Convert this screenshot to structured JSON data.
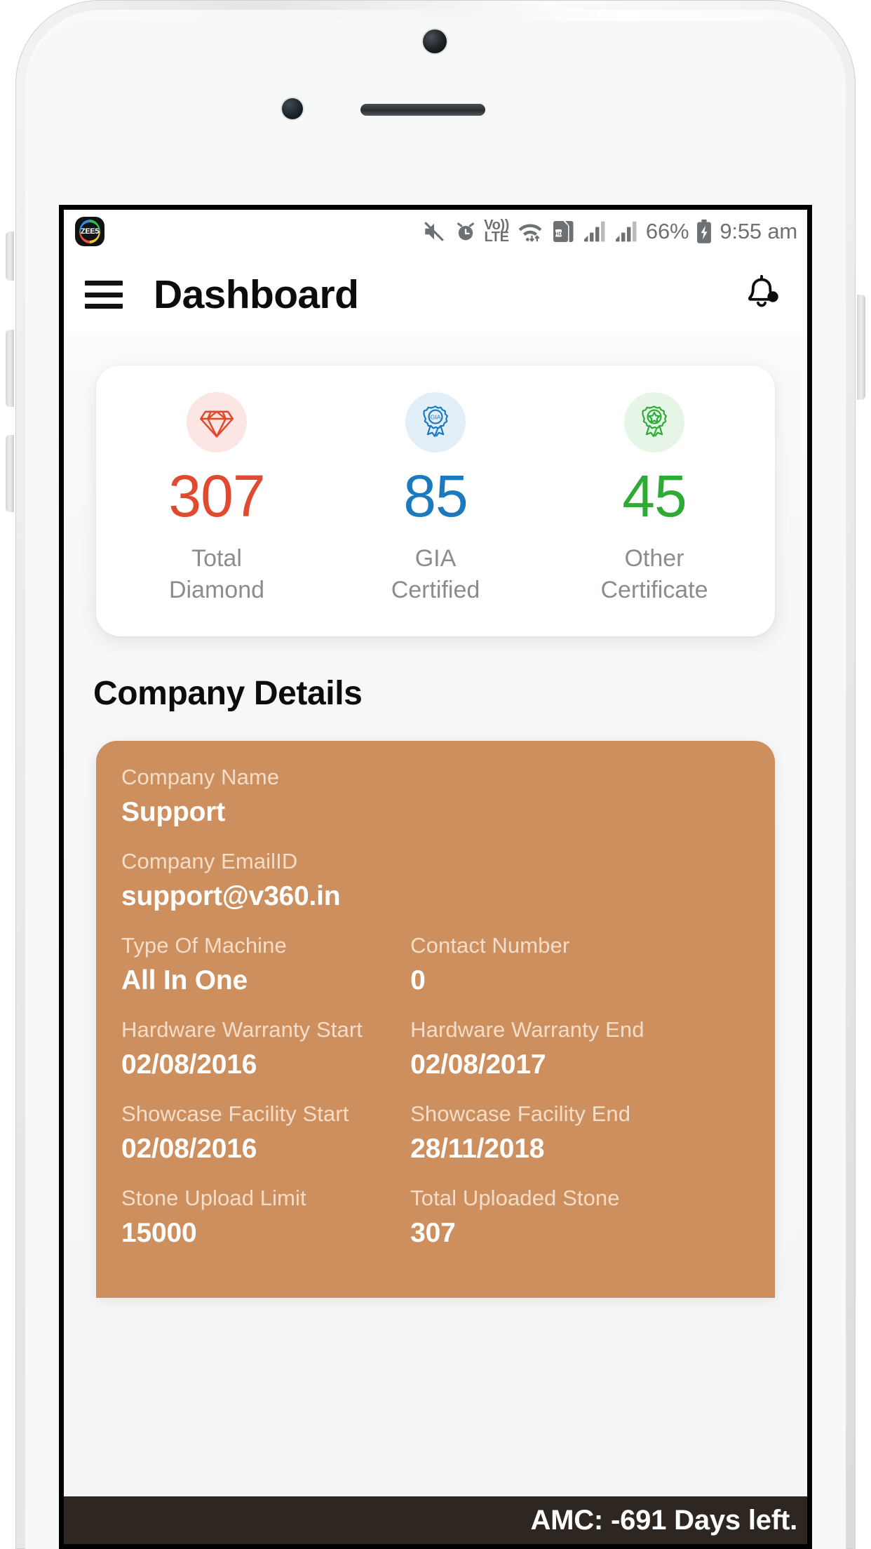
{
  "device": {
    "type": "smartphone-mockup",
    "frame_color": "#eceef0"
  },
  "statusbar": {
    "app_badge_label": "ZEE5",
    "icons": [
      "volume-mute-icon",
      "alarm-icon",
      "volte-icon",
      "wifi-icon",
      "sim-hd-icon",
      "signal-bars-icon-1",
      "signal-bars-icon-2",
      "battery-charging-icon"
    ],
    "volte_top": "Vo))",
    "volte_bottom": "LTE",
    "battery_percent": "66%",
    "time": "9:55 am"
  },
  "appbar": {
    "menu_icon": "hamburger-menu-icon",
    "title": "Dashboard",
    "notification_icon": "bell-icon"
  },
  "stats": {
    "items": [
      {
        "icon": "diamond-icon",
        "value": "307",
        "label_line1": "Total",
        "label_line2": "Diamond",
        "color": "#e04a2f",
        "bg": "#fbe6e3"
      },
      {
        "icon": "gia-badge-icon",
        "value": "85",
        "label_line1": "GIA",
        "label_line2": "Certified",
        "color": "#1b79c0",
        "bg": "#e2eff9"
      },
      {
        "icon": "star-badge-icon",
        "value": "45",
        "label_line1": "Other",
        "label_line2": "Certificate",
        "color": "#2eab36",
        "bg": "#e7f5e7"
      }
    ]
  },
  "company_details": {
    "section_title": "Company Details",
    "card_color": "#ce8f5e",
    "company_name_label": "Company Name",
    "company_name_value": "Support",
    "company_email_label": "Company EmailID",
    "company_email_value": "support@v360.in",
    "machine_type_label": "Type Of Machine",
    "machine_type_value": "All In One",
    "contact_number_label": "Contact Number",
    "contact_number_value": "0",
    "hw_warranty_start_label": "Hardware Warranty Start",
    "hw_warranty_start_value": "02/08/2016",
    "hw_warranty_end_label": "Hardware Warranty End",
    "hw_warranty_end_value": "02/08/2017",
    "showcase_start_label": "Showcase Facility Start",
    "showcase_start_value": "02/08/2016",
    "showcase_end_label": "Showcase Facility End",
    "showcase_end_value": "28/11/2018",
    "stone_limit_label": "Stone Upload Limit",
    "stone_limit_value": "15000",
    "total_uploaded_label": "Total Uploaded Stone",
    "total_uploaded_value": "307"
  },
  "amc_bar": {
    "text": "AMC:  -691 Days left."
  }
}
